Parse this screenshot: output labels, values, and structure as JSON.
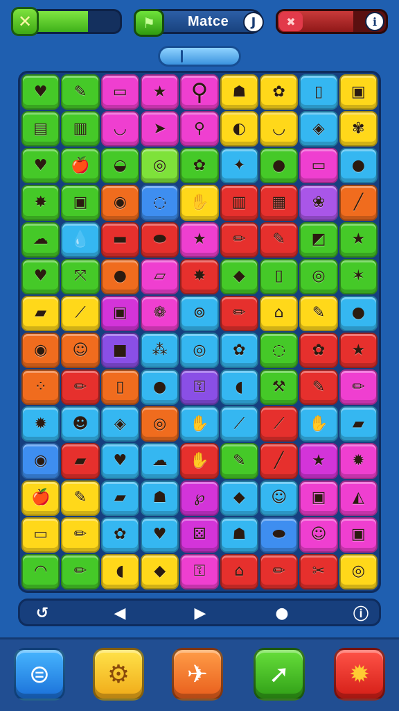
{
  "hud": {
    "close_icon": "✕",
    "close_progress": 0.7,
    "title": "Matce",
    "title_flag_icon": "flag-icon",
    "title_info_icon": "J",
    "danger_icon": "✖",
    "danger_progress": 0.7,
    "danger_info_icon": "ℹ"
  },
  "board": {
    "columns": 9,
    "rows": 14,
    "tiles": [
      {
        "r": 1,
        "c": 1,
        "color": "green",
        "icon": "♥"
      },
      {
        "r": 1,
        "c": 2,
        "color": "green",
        "icon": "✎"
      },
      {
        "r": 1,
        "c": 3,
        "color": "pink",
        "icon": "▭"
      },
      {
        "r": 1,
        "c": 4,
        "color": "pink",
        "icon": "★"
      },
      {
        "r": 1,
        "c": 5,
        "rs": 1,
        "cs": 1,
        "color": "pink",
        "icon": "⚲",
        "big": true
      },
      {
        "r": 1,
        "c": 6,
        "color": "yellow",
        "icon": "☗"
      },
      {
        "r": 1,
        "c": 7,
        "color": "yellow",
        "icon": "✿"
      },
      {
        "r": 1,
        "c": 8,
        "color": "cyan",
        "icon": "▯"
      },
      {
        "r": 1,
        "c": 9,
        "color": "yellow",
        "icon": "▣"
      },
      {
        "r": 2,
        "c": 1,
        "color": "green",
        "icon": "▤"
      },
      {
        "r": 2,
        "c": 2,
        "color": "green",
        "icon": "▥"
      },
      {
        "r": 2,
        "c": 3,
        "color": "pink",
        "icon": "◡"
      },
      {
        "r": 2,
        "c": 4,
        "color": "pink",
        "icon": "➤"
      },
      {
        "r": 2,
        "c": 5,
        "color": "pink",
        "icon": "⚲"
      },
      {
        "r": 2,
        "c": 6,
        "color": "yellow",
        "icon": "◐"
      },
      {
        "r": 2,
        "c": 7,
        "color": "yellow",
        "icon": "◡"
      },
      {
        "r": 2,
        "c": 8,
        "color": "cyan",
        "icon": "◈"
      },
      {
        "r": 2,
        "c": 9,
        "color": "yellow",
        "icon": "✾"
      },
      {
        "r": 3,
        "c": 1,
        "color": "green",
        "icon": "♥"
      },
      {
        "r": 3,
        "c": 2,
        "color": "green",
        "icon": "🍎"
      },
      {
        "r": 3,
        "c": 3,
        "color": "green",
        "icon": "◒"
      },
      {
        "r": 3,
        "c": 4,
        "color": "lime",
        "icon": "◎"
      },
      {
        "r": 3,
        "c": 5,
        "color": "green",
        "icon": "✿"
      },
      {
        "r": 3,
        "c": 6,
        "color": "cyan",
        "icon": "✦"
      },
      {
        "r": 3,
        "c": 7,
        "color": "green",
        "icon": "●"
      },
      {
        "r": 3,
        "c": 8,
        "color": "pink",
        "icon": "▭"
      },
      {
        "r": 3,
        "c": 9,
        "color": "cyan",
        "icon": "●"
      },
      {
        "r": 4,
        "c": 1,
        "color": "green",
        "icon": "✸"
      },
      {
        "r": 4,
        "c": 2,
        "color": "green",
        "icon": "▣"
      },
      {
        "r": 4,
        "c": 3,
        "color": "orange",
        "icon": "◉"
      },
      {
        "r": 4,
        "c": 4,
        "color": "blue",
        "icon": "◌"
      },
      {
        "r": 4,
        "c": 5,
        "color": "yellow",
        "icon": "✋"
      },
      {
        "r": 4,
        "c": 6,
        "color": "red",
        "icon": "▥"
      },
      {
        "r": 4,
        "c": 7,
        "color": "red",
        "icon": "▦"
      },
      {
        "r": 4,
        "c": 8,
        "color": "violet",
        "icon": "❀"
      },
      {
        "r": 4,
        "c": 9,
        "color": "orange",
        "icon": "╱"
      },
      {
        "r": 5,
        "c": 1,
        "color": "green",
        "icon": "☁"
      },
      {
        "r": 5,
        "c": 2,
        "color": "cyan",
        "icon": "💧"
      },
      {
        "r": 5,
        "c": 3,
        "color": "red",
        "icon": "▬"
      },
      {
        "r": 5,
        "c": 4,
        "color": "red",
        "icon": "⬬"
      },
      {
        "r": 5,
        "c": 5,
        "color": "pink",
        "icon": "★"
      },
      {
        "r": 5,
        "c": 6,
        "color": "red",
        "icon": "✏"
      },
      {
        "r": 5,
        "c": 7,
        "color": "red",
        "icon": "✎"
      },
      {
        "r": 5,
        "c": 8,
        "color": "green",
        "icon": "◩"
      },
      {
        "r": 5,
        "c": 9,
        "color": "green",
        "icon": "★"
      },
      {
        "r": 6,
        "c": 1,
        "color": "green",
        "icon": "♥"
      },
      {
        "r": 6,
        "c": 2,
        "color": "green",
        "icon": "⤧"
      },
      {
        "r": 6,
        "c": 3,
        "color": "orange",
        "icon": "●"
      },
      {
        "r": 6,
        "c": 4,
        "color": "pink",
        "icon": "▱"
      },
      {
        "r": 6,
        "c": 5,
        "color": "red",
        "icon": "✸"
      },
      {
        "r": 6,
        "c": 6,
        "color": "green",
        "icon": "◆"
      },
      {
        "r": 6,
        "c": 7,
        "color": "green",
        "icon": "▯"
      },
      {
        "r": 6,
        "c": 8,
        "color": "green",
        "icon": "◎"
      },
      {
        "r": 6,
        "c": 9,
        "color": "green",
        "icon": "✶"
      },
      {
        "r": 7,
        "c": 1,
        "color": "yellow",
        "icon": "▰"
      },
      {
        "r": 7,
        "c": 2,
        "color": "yellow",
        "icon": "⟋"
      },
      {
        "r": 7,
        "c": 3,
        "color": "magenta",
        "icon": "▣"
      },
      {
        "r": 7,
        "c": 4,
        "color": "pink",
        "icon": "❁"
      },
      {
        "r": 7,
        "c": 5,
        "color": "cyan",
        "icon": "⊚"
      },
      {
        "r": 7,
        "c": 6,
        "color": "red",
        "icon": "✏"
      },
      {
        "r": 7,
        "c": 7,
        "color": "yellow",
        "icon": "⌂"
      },
      {
        "r": 7,
        "c": 8,
        "color": "yellow",
        "icon": "✎"
      },
      {
        "r": 7,
        "c": 9,
        "color": "cyan",
        "icon": "●"
      },
      {
        "r": 8,
        "c": 1,
        "color": "orange",
        "icon": "◉"
      },
      {
        "r": 8,
        "c": 2,
        "color": "orange",
        "icon": "☺"
      },
      {
        "r": 8,
        "c": 3,
        "color": "purple",
        "icon": "■"
      },
      {
        "r": 8,
        "c": 4,
        "color": "cyan",
        "icon": "⁂"
      },
      {
        "r": 8,
        "c": 5,
        "color": "cyan",
        "icon": "◎"
      },
      {
        "r": 8,
        "c": 6,
        "color": "cyan",
        "icon": "✿"
      },
      {
        "r": 8,
        "c": 7,
        "color": "green",
        "icon": "◌"
      },
      {
        "r": 8,
        "c": 8,
        "color": "red",
        "icon": "✿"
      },
      {
        "r": 8,
        "c": 9,
        "color": "red",
        "icon": "★"
      },
      {
        "r": 9,
        "c": 1,
        "color": "orange",
        "icon": "⁘"
      },
      {
        "r": 9,
        "c": 2,
        "color": "red",
        "icon": "✏"
      },
      {
        "r": 9,
        "c": 3,
        "color": "orange",
        "icon": "▯"
      },
      {
        "r": 9,
        "c": 4,
        "color": "cyan",
        "icon": "●"
      },
      {
        "r": 9,
        "c": 5,
        "color": "purple",
        "icon": "⚿"
      },
      {
        "r": 9,
        "c": 6,
        "color": "cyan",
        "icon": "◖"
      },
      {
        "r": 9,
        "c": 7,
        "color": "green",
        "icon": "⚒"
      },
      {
        "r": 9,
        "c": 8,
        "color": "red",
        "icon": "✎"
      },
      {
        "r": 9,
        "c": 9,
        "color": "pink",
        "icon": "✏"
      },
      {
        "r": 10,
        "c": 1,
        "color": "cyan",
        "icon": "✹"
      },
      {
        "r": 10,
        "c": 2,
        "color": "cyan",
        "icon": "☻"
      },
      {
        "r": 10,
        "c": 3,
        "color": "cyan",
        "icon": "◈"
      },
      {
        "r": 10,
        "c": 4,
        "color": "orange",
        "icon": "◎"
      },
      {
        "r": 10,
        "c": 5,
        "color": "cyan",
        "icon": "✋"
      },
      {
        "r": 10,
        "c": 6,
        "color": "cyan",
        "icon": "⟋"
      },
      {
        "r": 10,
        "c": 7,
        "color": "red",
        "icon": "⟋"
      },
      {
        "r": 10,
        "c": 8,
        "color": "cyan",
        "icon": "✋"
      },
      {
        "r": 10,
        "c": 9,
        "color": "cyan",
        "icon": "▰"
      },
      {
        "r": 11,
        "c": 1,
        "color": "blue",
        "icon": "◉"
      },
      {
        "r": 11,
        "c": 2,
        "color": "red",
        "icon": "▰"
      },
      {
        "r": 11,
        "c": 3,
        "color": "cyan",
        "icon": "♥"
      },
      {
        "r": 11,
        "c": 4,
        "color": "cyan",
        "icon": "☁"
      },
      {
        "r": 11,
        "c": 5,
        "color": "red",
        "icon": "✋"
      },
      {
        "r": 11,
        "c": 6,
        "color": "green",
        "icon": "✎"
      },
      {
        "r": 11,
        "c": 7,
        "color": "red",
        "icon": "╱"
      },
      {
        "r": 11,
        "c": 8,
        "color": "magenta",
        "icon": "★"
      },
      {
        "r": 11,
        "c": 9,
        "color": "pink",
        "icon": "✹"
      },
      {
        "r": 12,
        "c": 1,
        "color": "yellow",
        "icon": "🍎"
      },
      {
        "r": 12,
        "c": 2,
        "color": "yellow",
        "icon": "✎"
      },
      {
        "r": 12,
        "c": 3,
        "color": "cyan",
        "icon": "▰"
      },
      {
        "r": 12,
        "c": 4,
        "color": "cyan",
        "icon": "☗"
      },
      {
        "r": 12,
        "c": 5,
        "color": "magenta",
        "icon": "℘"
      },
      {
        "r": 12,
        "c": 6,
        "color": "cyan",
        "icon": "◆"
      },
      {
        "r": 12,
        "c": 7,
        "color": "cyan",
        "icon": "☺"
      },
      {
        "r": 12,
        "c": 8,
        "color": "pink",
        "icon": "▣"
      },
      {
        "r": 12,
        "c": 9,
        "color": "pink",
        "icon": "◭"
      },
      {
        "r": 13,
        "c": 1,
        "color": "yellow",
        "icon": "▭"
      },
      {
        "r": 13,
        "c": 2,
        "color": "yellow",
        "icon": "✏"
      },
      {
        "r": 13,
        "c": 3,
        "color": "cyan",
        "icon": "✿"
      },
      {
        "r": 13,
        "c": 4,
        "color": "cyan",
        "icon": "♥"
      },
      {
        "r": 13,
        "c": 5,
        "color": "magenta",
        "icon": "⚄"
      },
      {
        "r": 13,
        "c": 6,
        "color": "cyan",
        "icon": "☗"
      },
      {
        "r": 13,
        "c": 7,
        "color": "blue",
        "icon": "⬬"
      },
      {
        "r": 13,
        "c": 8,
        "color": "pink",
        "icon": "☺"
      },
      {
        "r": 13,
        "c": 9,
        "color": "pink",
        "icon": "▣"
      },
      {
        "r": 14,
        "c": 1,
        "color": "green",
        "icon": "◠"
      },
      {
        "r": 14,
        "c": 2,
        "color": "green",
        "icon": "✏"
      },
      {
        "r": 14,
        "c": 3,
        "color": "yellow",
        "icon": "◖"
      },
      {
        "r": 14,
        "c": 4,
        "color": "yellow",
        "icon": "◆"
      },
      {
        "r": 14,
        "c": 5,
        "color": "pink",
        "icon": "⚿"
      },
      {
        "r": 14,
        "c": 6,
        "color": "red",
        "icon": "⌂"
      },
      {
        "r": 14,
        "c": 7,
        "color": "red",
        "icon": "✏"
      },
      {
        "r": 14,
        "c": 8,
        "color": "red",
        "icon": "✂"
      },
      {
        "r": 14,
        "c": 9,
        "color": "yellow",
        "icon": "◎"
      }
    ]
  },
  "toolbar": {
    "undo_icon": "↺",
    "prev_icon": "◀",
    "next_icon": "▶",
    "dot_icon": "●",
    "info_icon": "ⓘ"
  },
  "dock": [
    {
      "name": "search-dock-button",
      "icon": "⊜",
      "color": "blue"
    },
    {
      "name": "settings-dock-button",
      "icon": "⚙",
      "color": "yellow"
    },
    {
      "name": "plane-dock-button",
      "icon": "✈",
      "color": "orange"
    },
    {
      "name": "arrow-dock-button",
      "icon": "➚",
      "color": "green"
    },
    {
      "name": "gear-dock-button",
      "icon": "✹",
      "color": "red"
    }
  ]
}
